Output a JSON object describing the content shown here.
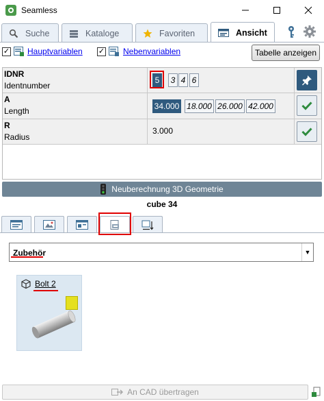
{
  "window": {
    "title": "Seamless"
  },
  "main_tabs": [
    {
      "label": "Suche"
    },
    {
      "label": "Kataloge"
    },
    {
      "label": "Favoriten"
    },
    {
      "label": "Ansicht"
    }
  ],
  "options": {
    "main_vars_label": "Hauptvariablen",
    "side_vars_label": "Nebenvariablen",
    "main_vars_checked": true,
    "side_vars_checked": true,
    "table_button": "Tabelle anzeigen"
  },
  "variables": [
    {
      "name": "IDNR",
      "description": "Identnumber",
      "values": [
        "5",
        "3",
        "4",
        "6"
      ],
      "selected": "5"
    },
    {
      "name": "A",
      "description": "Length",
      "values": [
        "34.000",
        "18.000",
        "26.000",
        "42.000"
      ],
      "selected": "34.000"
    },
    {
      "name": "R",
      "description": "Radius",
      "value": "3.000"
    }
  ],
  "recalc_button": "Neuberechnung 3D Geometrie",
  "part_name": "cube 34",
  "category_select": {
    "value": "Zubehör"
  },
  "accessories": [
    {
      "title": "Bolt 2"
    }
  ],
  "cad_button": "An CAD übertragen",
  "colors": {
    "accent": "#2f5a7e",
    "recalc": "#6f8596",
    "highlight": "#e00000",
    "ok": "#2e8b3e"
  },
  "icons": [
    "app-icon",
    "minimize-icon",
    "maximize-icon",
    "close-icon",
    "search-icon",
    "catalog-icon",
    "star-icon",
    "view-icon",
    "key-icon",
    "gear-icon",
    "pin-icon",
    "check-icon",
    "traffic-light-icon",
    "cube-icon",
    "cad-transfer-icon",
    "resize-grip-icon"
  ]
}
